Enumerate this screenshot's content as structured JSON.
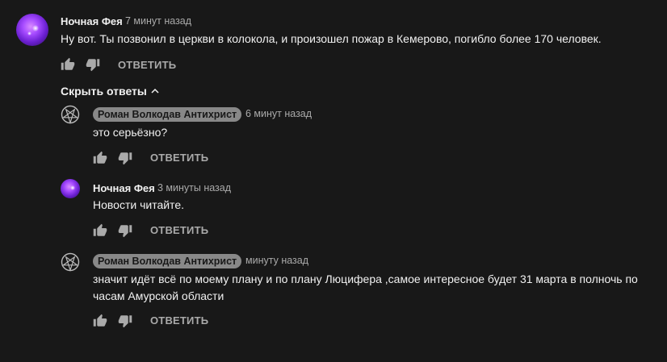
{
  "comments": [
    {
      "author": "Ночная Фея",
      "time": "7 минут назад",
      "text": "Ну вот. Ты позвонил в церкви в колокола, и произошел пожар в Кемерово, погибло более 170 человек.",
      "reply_label": "ОТВЕТИТЬ"
    }
  ],
  "hide_replies_label": "Скрыть ответы",
  "replies": [
    {
      "author": "Роман Волкодав Антихрист",
      "time": "6 минут назад",
      "text": "это серьёзно?",
      "reply_label": "ОТВЕТИТЬ"
    },
    {
      "author": "Ночная Фея",
      "time": "3 минуты назад",
      "text": "Новости читайте.",
      "reply_label": "ОТВЕТИТЬ"
    },
    {
      "author": "Роман Волкодав Антихрист",
      "time": "минуту назад",
      "text_line1": "значит идёт всё по моему плану и по плану Люцифера ,самое интересное будет 31 марта в полночь по",
      "text_line2": "часам Амурской области",
      "reply_label": "ОТВЕТИТЬ"
    }
  ],
  "colors": {
    "background": "#181818",
    "text": "#f1f1f1",
    "secondary": "#aaaaaa",
    "badge": "#888888"
  },
  "icons": [
    "like-icon",
    "dislike-icon",
    "chevron-up-icon",
    "pentagram-avatar",
    "fairy-avatar"
  ]
}
